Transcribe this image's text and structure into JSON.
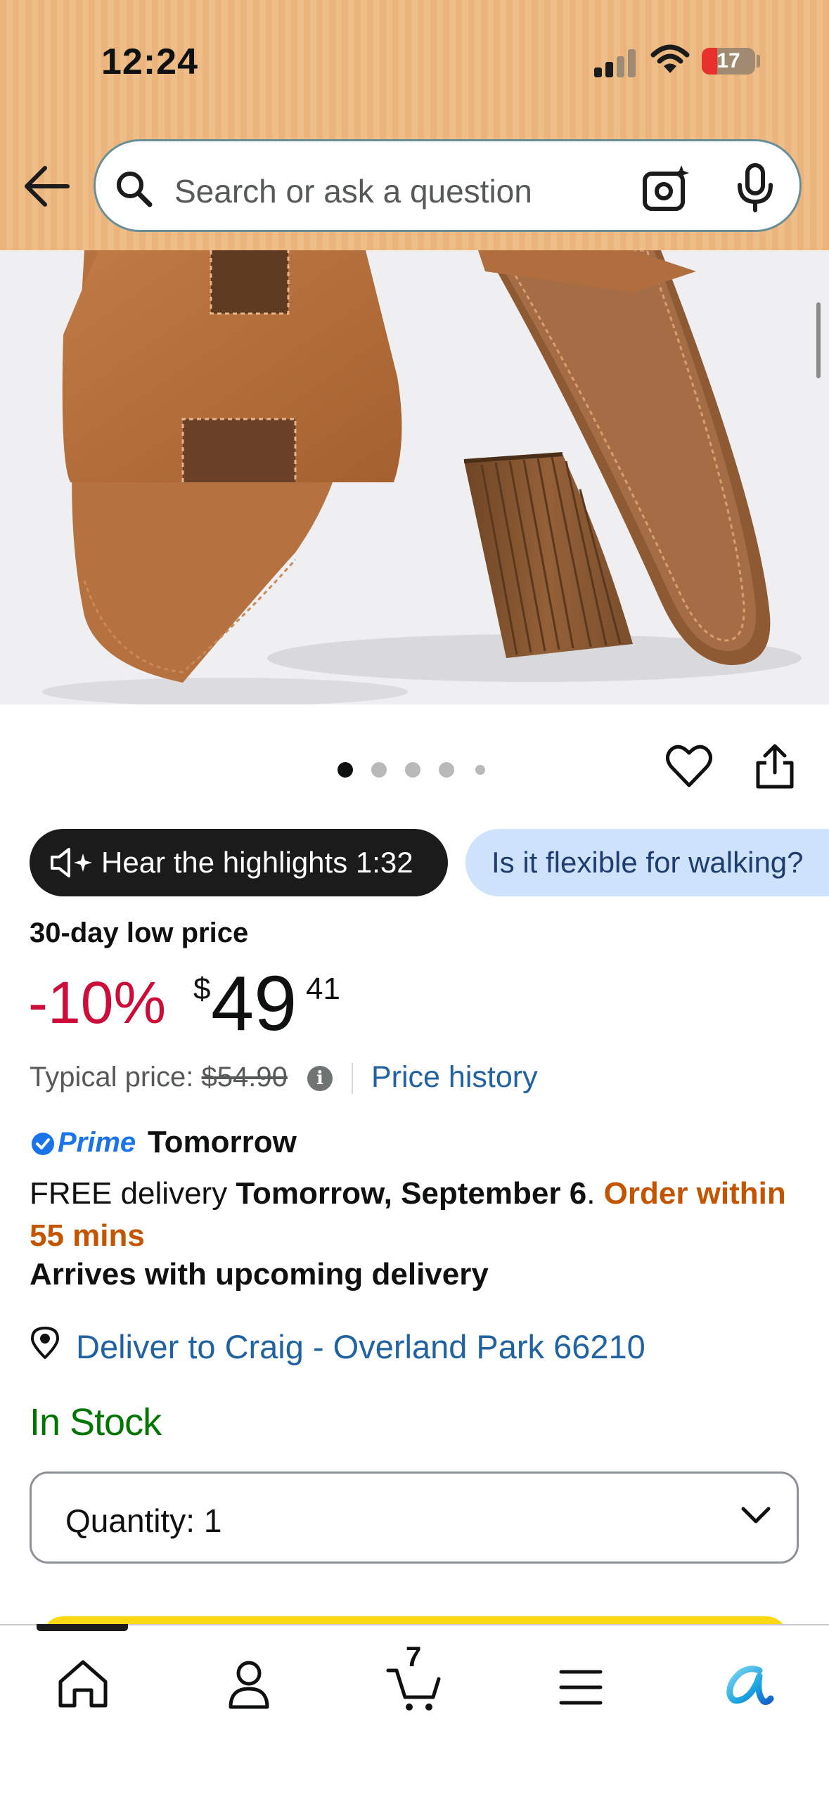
{
  "status_bar": {
    "time": "12:24",
    "battery_level": "17"
  },
  "header": {
    "search_placeholder": "Search or ask a question"
  },
  "carousel": {
    "dot_count": 5,
    "active_index": 0
  },
  "pills": {
    "audio_label": "Hear the highlights 1:32",
    "question_label": "Is it flexible for walking?"
  },
  "price": {
    "low_label": "30-day low price",
    "discount": "-10%",
    "currency": "$",
    "whole": "49",
    "fraction": "41",
    "typical_label": "Typical price:",
    "typical_value": "$54.90",
    "history_link": "Price history"
  },
  "delivery": {
    "prime_label": "Prime",
    "prime_day": "Tomorrow",
    "free_prefix": "FREE delivery ",
    "date": "Tomorrow, September 6",
    "period": ". ",
    "order_within": "Order within 55 mins",
    "arrives": "Arrives with upcoming delivery",
    "deliver_to": "Deliver to Craig - Overland Park 66210"
  },
  "stock": {
    "status": "In Stock"
  },
  "quantity": {
    "label": "Quantity:",
    "value": "1"
  },
  "tabbar": {
    "cart_count": "7",
    "items": [
      "home-icon",
      "account-icon",
      "cart-icon",
      "menu-icon",
      "rufus-ai-icon"
    ]
  },
  "colors": {
    "header_bg": "#ebb47c",
    "discount": "#cc0c39",
    "link": "#2162a1",
    "order_within": "#c45500",
    "in_stock": "#007600",
    "prime_blue": "#1a73e8",
    "buy_button": "#ffd814"
  }
}
